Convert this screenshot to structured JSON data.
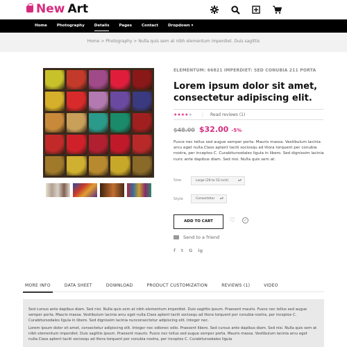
{
  "header": {
    "logo_part1": "New",
    "logo_part2": "Art",
    "icons": [
      "settings-icon",
      "search-icon",
      "compare-icon",
      "cart-icon"
    ]
  },
  "nav": {
    "items": [
      "Home",
      "Photography",
      "Details",
      "Pages",
      "Contact",
      "Dropdown ▾"
    ],
    "active": "Details"
  },
  "breadcrumb": "Home > Photography > Nulla quis sem at nibh elementum imperdiet. Duis sagittis",
  "product": {
    "reference": "ELEMENTUM: 66821 IMPERDIET: SED CONUBIA 211 PORTA",
    "title": "Lorem ipsum dolor sit amet, consectetur adipiscing elit.",
    "rating_stars": 3.5,
    "reviews_label": "Read reviews (1)",
    "old_price": "$48.00",
    "price": "$32.00",
    "discount": "-5%",
    "description": "Fusce nec tellus sed augue semper porta. Mauris massa. Vestibulum lacinia arcu eget nulla.Class aptent taciti sociosqu ad litora torquent per conubia nostra, per inceptos C. Curabitursodales ligula in libero. Sed dignissim lacinia nunc ante dapibus diam. Sed nisi. Nulla quis sem at.",
    "size_label": "Size",
    "size_value": "Large (26 to 52 inch)",
    "style_label": "Style",
    "style_value": "Consectetur",
    "add_to_cart": "ADD TO CART",
    "send_friend": "Send to a friend",
    "social": [
      "f",
      "t",
      "G",
      "ig"
    ]
  },
  "tabs": {
    "items": [
      "MORE INFO",
      "DATA SHEET",
      "DOWNLOAD",
      "PRODUCT CUSTOMIZATION",
      "REVIEWS (1)",
      "VIDEO"
    ],
    "active": "MORE INFO",
    "body": [
      "Sed cursus ante dapibus diam. Sed nisi. Nulla quis sem at nibh elementum imperdiet. Duis sagittis ipsum. Praesent mauris. Fusce nec tellus sed augue semper porta. Mauris massa. Vestibulum lacinia arcu eget nulla.Class aptent taciti sociosqu ad litora torquent per conubia nostra, per inceptos C. Curabitursodales ligula in libero. Sed dignissim lacinia nunconsectetur adipiscing elit. Integer nec.",
      "Lorem ipsum dolor sit amet, consectetur adipiscing elit. Integer nec odionec odio. Praesent libero. Sed cursus ante dapibus diam. Sed nisi. Nulla quis sem at nibh elementum imperdiet. Duis sagittis ipsum. Praesent mauris. Fusce nec tellus sed augue semper porta. Mauris massa. Vestibulum lacinia arcu eget nulla.Class aptent taciti sociosqu ad litora torquent per conubia nostra, per inceptos C. Curabitursodales ligula"
    ]
  },
  "colors": {
    "accent": "#d62b7d",
    "nav_bg": "#000000",
    "crumb_bg": "#f2f2f2"
  },
  "image_palette": [
    "#c8c22a",
    "#c43a2a",
    "#a04a8a",
    "#e01e3c",
    "#8a1818",
    "#d6b02a",
    "#d82a2a",
    "#b27ab0",
    "#6a4aa0",
    "#3a3a80",
    "#c88a3a",
    "#c8a05a",
    "#2a9a8a",
    "#1a8a6a",
    "#a02020",
    "#c22a2a",
    "#d0202a",
    "#b02030",
    "#c01a2a",
    "#b82a2a",
    "#a07a2a",
    "#d0b030",
    "#b88a30",
    "#c8a828",
    "#8a6a28"
  ]
}
